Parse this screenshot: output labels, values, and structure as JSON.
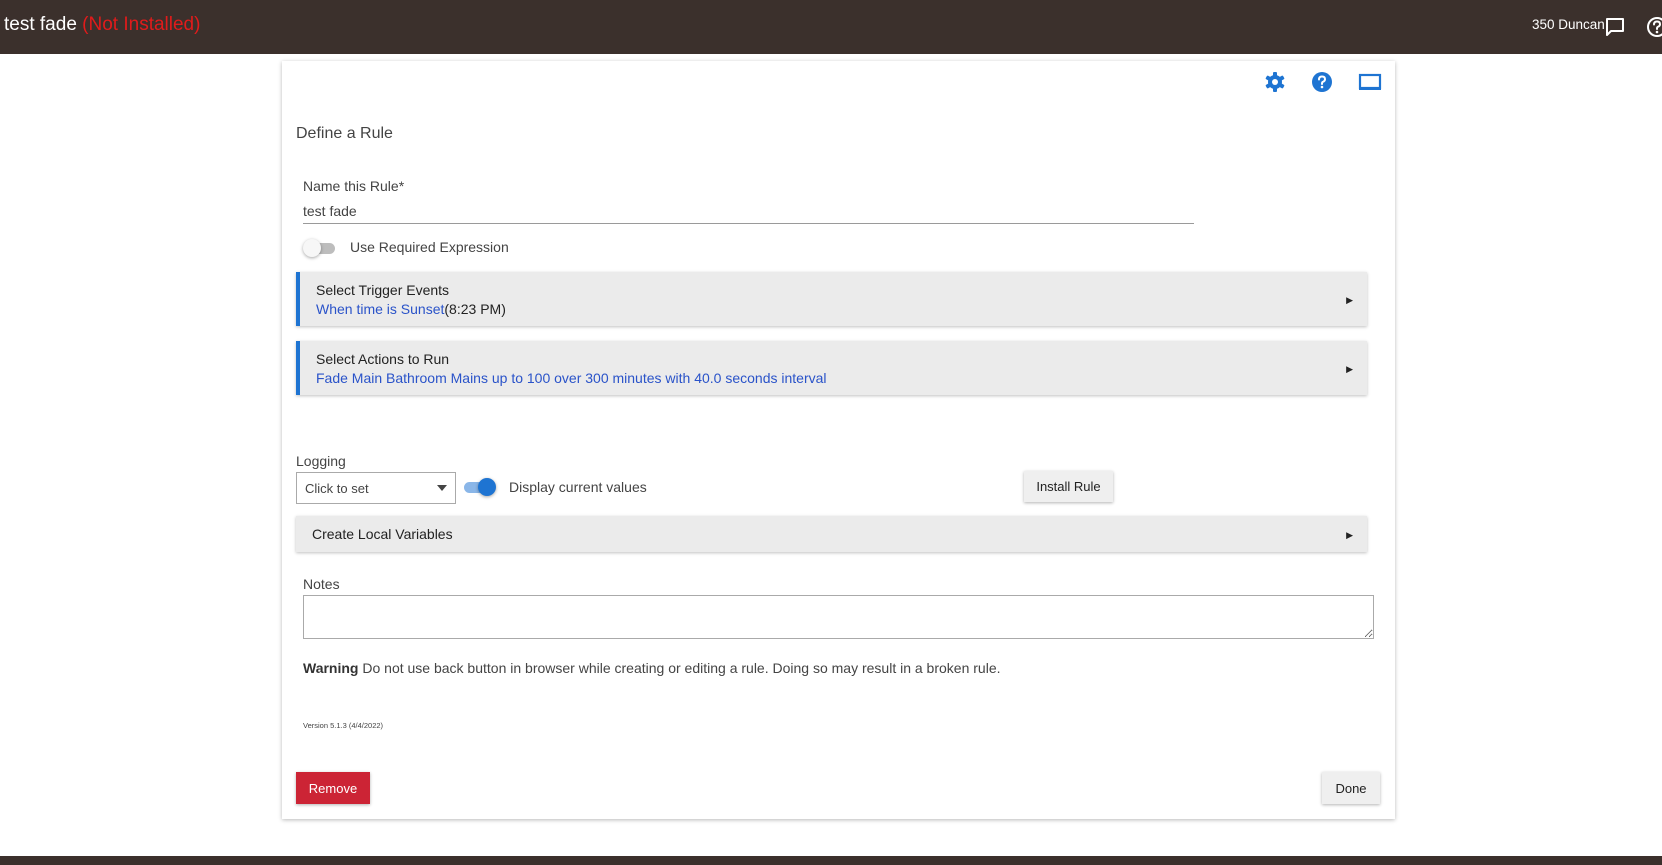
{
  "header": {
    "app_name": "test fade",
    "status": "(Not Installed)",
    "hub_name": "350 Duncan",
    "icons": [
      "chat-bubble-icon",
      "help-circle-icon"
    ]
  },
  "card": {
    "toolbar_icons": [
      "gear-icon",
      "help-icon",
      "monitor-icon"
    ],
    "heading": "Define a Rule",
    "name_field": {
      "label": "Name this Rule*",
      "value": "test fade"
    },
    "required_expression": {
      "label": "Use Required Expression",
      "enabled": false
    },
    "sections": {
      "trigger": {
        "title": "Select Trigger Events",
        "summary_link": "When time is Sunset",
        "summary_extra": "(8:23 PM)"
      },
      "actions": {
        "title": "Select Actions to Run",
        "summary": "Fade Main Bathroom Mains up to 100 over 300 minutes with 40.0 seconds interval"
      },
      "local_vars": {
        "title": "Create Local Variables"
      }
    },
    "logging": {
      "label": "Logging",
      "selected": "Click to set"
    },
    "display_values": {
      "label": "Display current values",
      "enabled": true
    },
    "install_button": "Install Rule",
    "notes": {
      "label": "Notes",
      "value": ""
    },
    "warning": {
      "bold": "Warning",
      "text": " Do not use back button in browser while creating or editing a rule. Doing so may result in a broken rule."
    },
    "version": "Version 5.1.3 (4/4/2022)",
    "remove_button": "Remove",
    "done_button": "Done"
  },
  "colors": {
    "header_bg": "#3b302c",
    "status_red": "#e01b1b",
    "accent_blue": "#1e74d2",
    "link_blue": "#2a53c9",
    "remove_red": "#cc2435"
  }
}
